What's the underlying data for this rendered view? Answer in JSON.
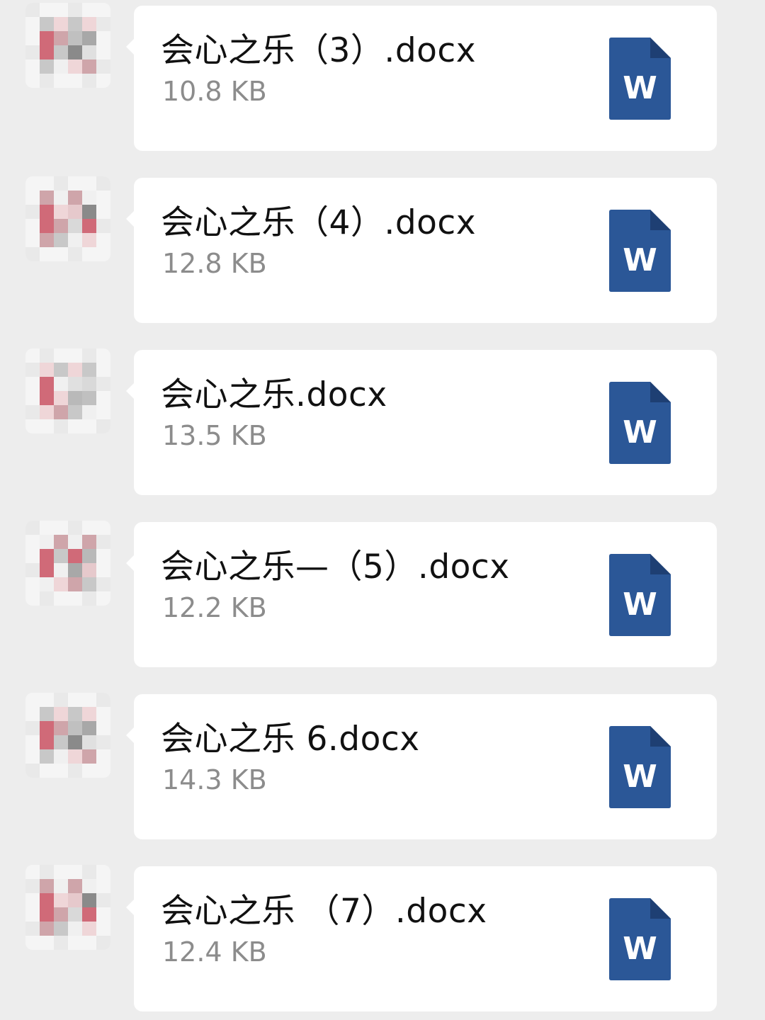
{
  "messages": [
    {
      "file_name": "会心之乐（3）.docx",
      "file_size": "10.8 KB",
      "file_type_icon": "word-doc-icon",
      "icon_letter": "W",
      "sender_avatar": "blurred-avatar"
    },
    {
      "file_name": "会心之乐（4）.docx",
      "file_size": "12.8 KB",
      "file_type_icon": "word-doc-icon",
      "icon_letter": "W",
      "sender_avatar": "blurred-avatar"
    },
    {
      "file_name": "会心之乐.docx",
      "file_size": "13.5 KB",
      "file_type_icon": "word-doc-icon",
      "icon_letter": "W",
      "sender_avatar": "blurred-avatar"
    },
    {
      "file_name": "会心之乐—（5）.docx",
      "file_size": "12.2 KB",
      "file_type_icon": "word-doc-icon",
      "icon_letter": "W",
      "sender_avatar": "blurred-avatar"
    },
    {
      "file_name": "会心之乐 6.docx",
      "file_size": "14.3 KB",
      "file_type_icon": "word-doc-icon",
      "icon_letter": "W",
      "sender_avatar": "blurred-avatar"
    },
    {
      "file_name": "会心之乐 （7）.docx",
      "file_size": "12.4 KB",
      "file_type_icon": "word-doc-icon",
      "icon_letter": "W",
      "sender_avatar": "blurred-avatar"
    }
  ],
  "colors": {
    "background": "#ededed",
    "bubble": "#ffffff",
    "word_blue": "#2b5797",
    "word_fold": "#1e3f73",
    "file_name_text": "#111111",
    "file_size_text": "#8c8c8c"
  }
}
